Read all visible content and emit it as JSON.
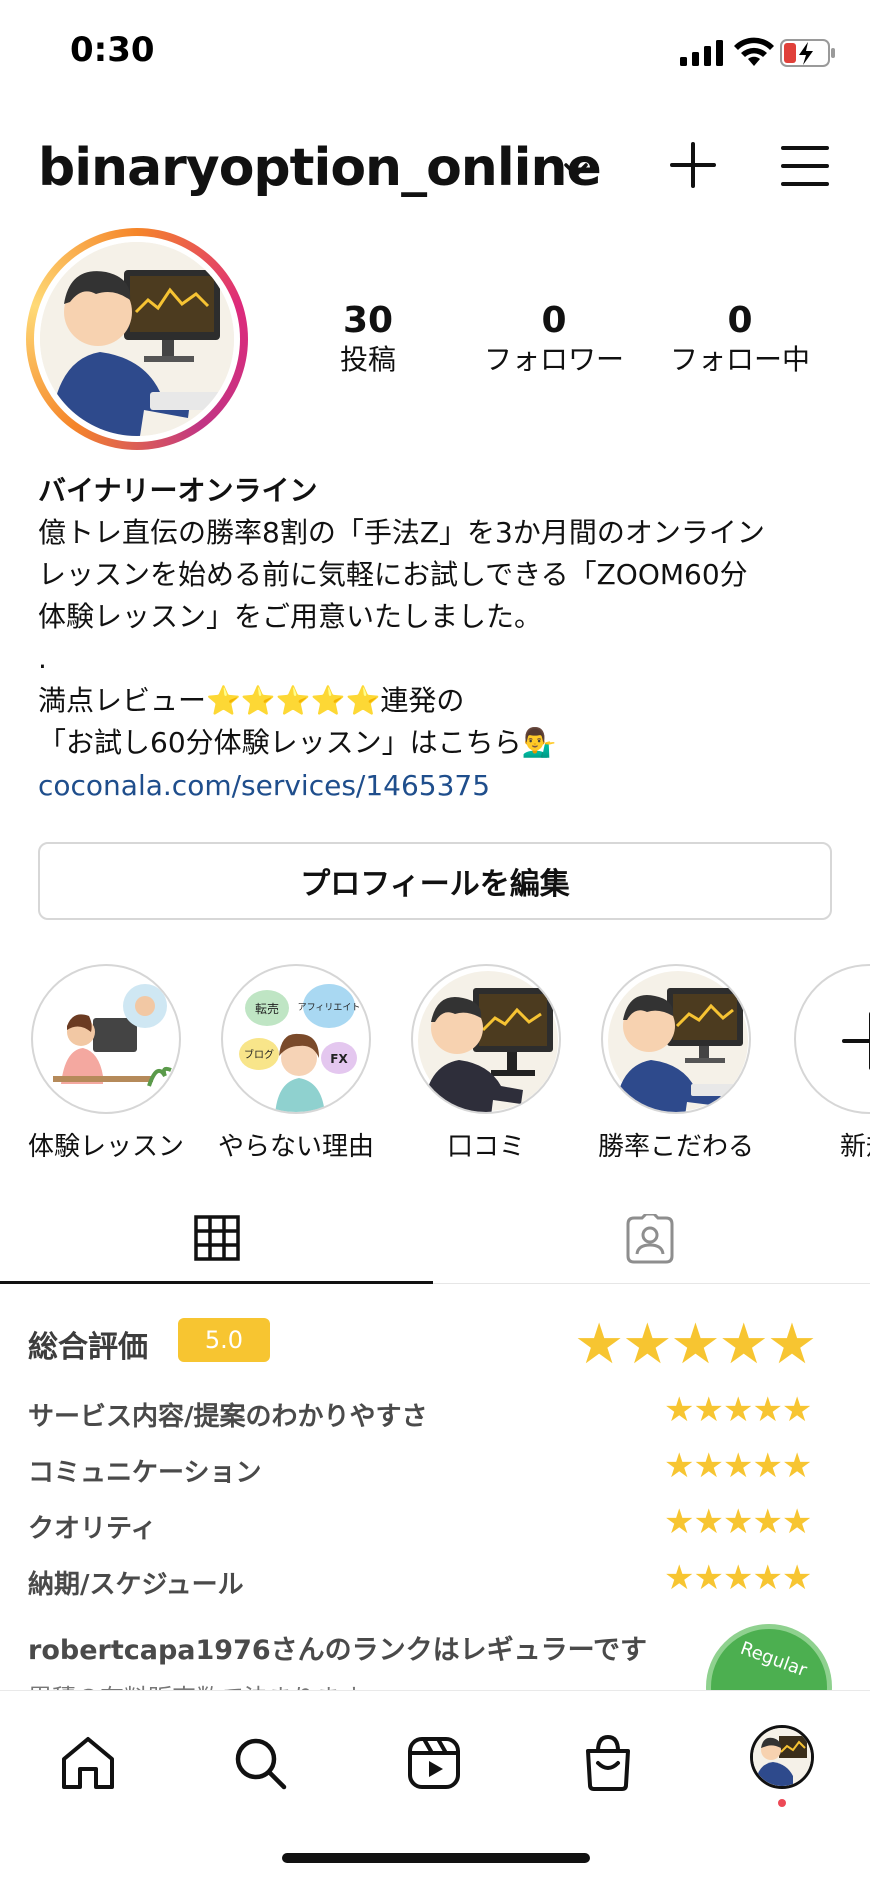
{
  "status_bar": {
    "time": "0:30"
  },
  "header": {
    "username": "binaryoption_online"
  },
  "stats": [
    {
      "value": "30",
      "label": "投稿"
    },
    {
      "value": "0",
      "label": "フォロワー"
    },
    {
      "value": "0",
      "label": "フォロー中"
    }
  ],
  "bio": {
    "name": "バイナリーオンライン",
    "line1": "億トレ直伝の勝率8割の「手法Z」を3か月間のオンライン",
    "line2": "レッスンを始める前に気軽にお試しできる「ZOOM60分",
    "line3": "体験レッスン」をご用意いたしました。",
    "line4": ".",
    "line5_prefix": "満点レビュー",
    "line5_stars": "⭐⭐⭐⭐⭐",
    "line5_suffix": "連発の",
    "line6": "「お試し60分体験レッスン」はこちら💁‍♂️",
    "link": "coconala.com/services/1465375"
  },
  "edit_profile_label": "プロフィールを編集",
  "highlights": [
    {
      "label": "体験レッスン"
    },
    {
      "label": "やらない理由"
    },
    {
      "label": "口コミ"
    },
    {
      "label": "勝率こだわる"
    },
    {
      "label": "新規"
    }
  ],
  "highlight_bubbles": [
    "転売",
    "アフィリエイト",
    "ブログ",
    "FX"
  ],
  "review": {
    "overall_label": "総合評価",
    "score": "5.0",
    "big_stars": "★★★★★",
    "criteria": [
      {
        "label": "サービス内容/提案のわかりやすさ",
        "stars": "★★★★★"
      },
      {
        "label": "コミュニケーション",
        "stars": "★★★★★"
      },
      {
        "label": "クオリティ",
        "stars": "★★★★★"
      },
      {
        "label": "納期/スケジュール",
        "stars": "★★★★★"
      }
    ],
    "rank_text": "robertcapa1976さんのランクはレギュラーです",
    "rank_sub": "累積の有料販売数で決まります",
    "rank_badge": "Regular"
  },
  "colors": {
    "star": "#f7c531",
    "link": "#1f4e8c",
    "notification": "#ed4956"
  },
  "icons": [
    "home-icon",
    "search-icon",
    "reels-icon",
    "shop-icon",
    "grid-icon",
    "tagged-icon",
    "plus-icon",
    "menu-icon"
  ]
}
